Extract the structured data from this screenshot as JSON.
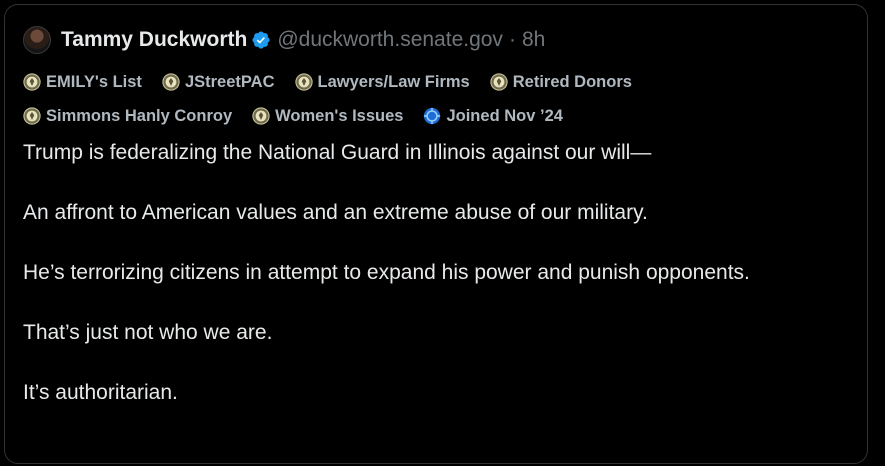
{
  "post": {
    "author_name": "Tammy Duckworth",
    "handle": "@duckworth.senate.gov",
    "separator": "·",
    "time": "8h",
    "verified_icon": "verified-badge-icon",
    "avatar_icon": "avatar",
    "tags_row1": [
      {
        "label": "EMILY's List",
        "icon": "seal-icon"
      },
      {
        "label": "JStreetPAC",
        "icon": "seal-icon"
      },
      {
        "label": "Lawyers/Law Firms",
        "icon": "seal-icon"
      },
      {
        "label": "Retired Donors",
        "icon": "seal-icon"
      }
    ],
    "tags_row2": [
      {
        "label": "Simmons Hanly Conroy",
        "icon": "seal-icon"
      },
      {
        "label": "Women's Issues",
        "icon": "seal-icon"
      },
      {
        "label": "Joined Nov ’24",
        "icon": "joined-icon"
      }
    ],
    "paragraphs": [
      "Trump is federalizing the National Guard in Illinois against our will—",
      "An affront to American values and an extreme abuse of our military.",
      "He’s terrorizing citizens in attempt to expand his power and punish opponents.",
      "That’s just not who we are.",
      "It’s authoritarian."
    ],
    "colors": {
      "background": "#000000",
      "border": "#2f3336",
      "text": "#e7e9ea",
      "muted": "#71767b",
      "tag_text": "#b0b8c0",
      "verified": "#1d9bf0"
    }
  }
}
